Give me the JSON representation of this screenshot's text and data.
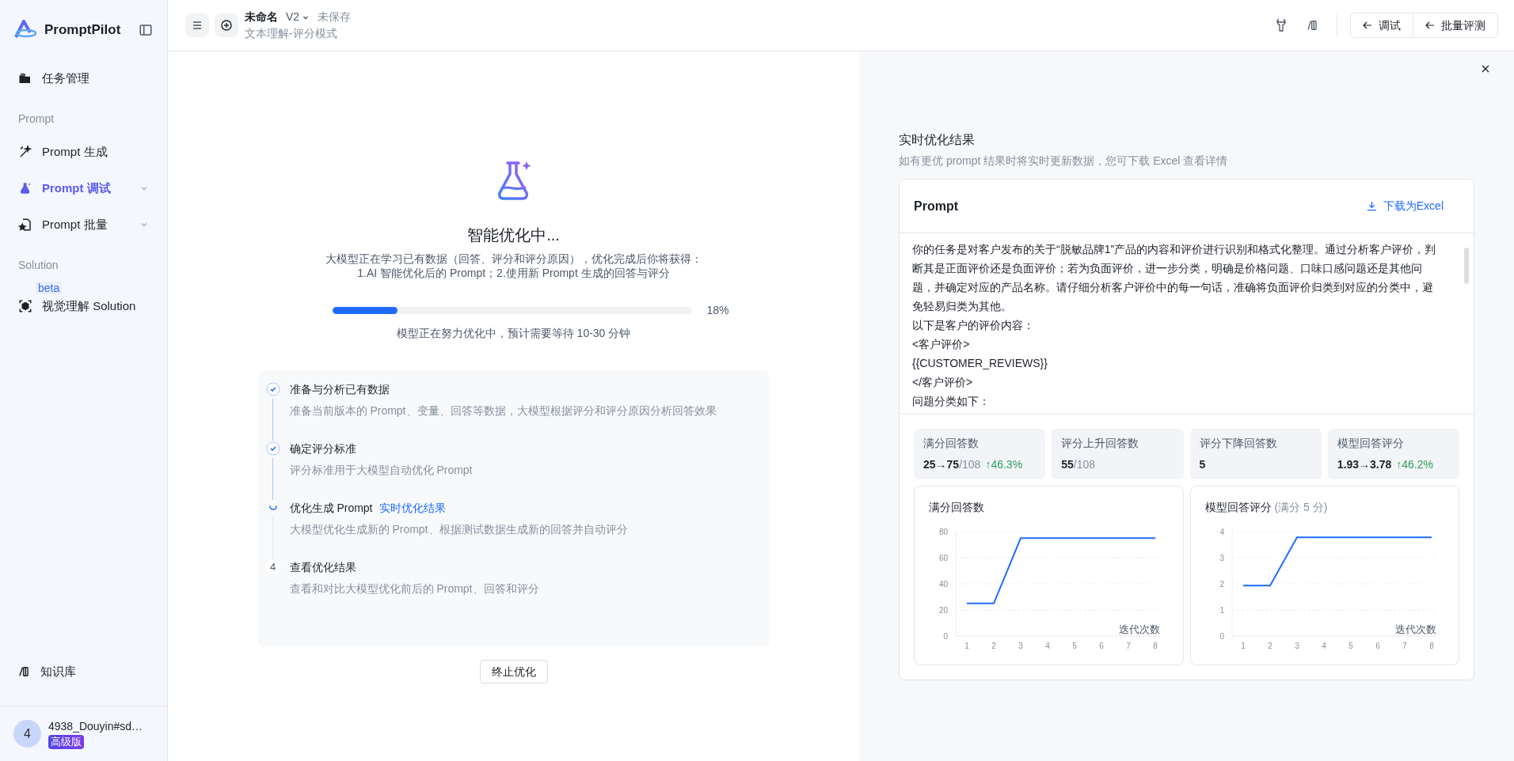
{
  "sidebar": {
    "logo": "PromptPilot",
    "items": [
      {
        "kind": "item",
        "label": "任务管理",
        "selected": false,
        "expandable": false
      },
      {
        "kind": "section",
        "label": "Prompt"
      },
      {
        "kind": "item",
        "label": "Prompt 生成",
        "selected": false,
        "expandable": false
      },
      {
        "kind": "item",
        "label": "Prompt 调试",
        "selected": true,
        "expandable": true
      },
      {
        "kind": "item",
        "label": "Prompt 批量",
        "selected": false,
        "expandable": true
      },
      {
        "kind": "section",
        "label": "Solution"
      },
      {
        "kind": "item",
        "label": "视觉理解 Solution",
        "selected": false,
        "expandable": false,
        "badge": "beta"
      }
    ],
    "bottom_item": "知识库",
    "user": {
      "avatar": "4",
      "name": "4938_Douyin#sd…",
      "plan": "高级版"
    }
  },
  "header": {
    "title": "未命名",
    "version": "V2",
    "save_state": "未保存",
    "subtitle": "文本理解-评分模式",
    "buttons": [
      "调试",
      "批量评测"
    ]
  },
  "optimization": {
    "title": "智能优化中...",
    "description": [
      "大模型正在学习已有数据（回答、评分和评分原因），优化完成后你将获得：",
      "1.AI 智能优化后的 Prompt；2.使用新 Prompt 生成的回答与评分"
    ],
    "progress": {
      "level": 0.18,
      "reading": "18%"
    },
    "eta": "模型正在努力优化中，预计需要等待 10-30 分钟",
    "steps": [
      {
        "kind": "done",
        "title": "准备与分析已有数据",
        "description": "准备当前版本的 Prompt、变量、回答等数据，大模型根据评分和评分原因分析回答效果"
      },
      {
        "kind": "done",
        "title": "确定评分标准",
        "description": "评分标准用于大模型自动优化 Prompt"
      },
      {
        "kind": "running",
        "title": "优化生成 Prompt",
        "link": "实时优化结果",
        "description": "大模型优化生成新的 Prompt、根据测试数据生成新的回答并自动评分"
      },
      {
        "kind": "pending",
        "marker": "4",
        "title": "查看优化结果",
        "description": "查看和对比大模型优化前后的 Prompt、回答和评分"
      }
    ],
    "stop_button": "终止优化"
  },
  "results": {
    "title": "实时优化结果",
    "subtitle": "如有更优 prompt 结果时将实时更新数据，您可下载 Excel 查看详情",
    "card_title": "Prompt",
    "download": "下载为Excel",
    "prompt_lines": [
      "你的任务是对客户发布的关于“脱敏品牌1”产品的内容和评价进行识别和格式化整理。通过分析客户评价，判断其是正面评价还是负面评价；若为负面评价，进一步分类，明确是价格问题、口味口感问题还是其他问题，并确定对应的产品名称。请仔细分析客户评价中的每一句话，准确将负面评价归类到对应的分类中，避免轻易归类为其他。",
      "以下是客户的评价内容：",
      "<客户评价>",
      "{{CUSTOMER_REVIEWS}}",
      "</客户评价>",
      "问题分类如下："
    ],
    "stats": [
      {
        "label": "满分回答数",
        "value": "25→75",
        "total": "/108",
        "change": "↑46.3%"
      },
      {
        "label": "评分上升回答数",
        "value": "55",
        "total": "/108"
      },
      {
        "label": "评分下降回答数",
        "value": "5"
      },
      {
        "label": "模型回答评分",
        "value": "1.93→3.78",
        "change": "↑46.2%"
      }
    ],
    "charts": [
      {
        "chart_data": {
          "type": "line",
          "title": "满分回答数",
          "xlabel": "迭代次数",
          "grid": true,
          "x": [
            1,
            2,
            3,
            4,
            5,
            6,
            7,
            8
          ],
          "ylim": [
            0,
            80
          ],
          "yticks": [
            0,
            20,
            40,
            60,
            80
          ],
          "series": [
            {
              "color": "#1f6bff",
              "values": [
                25,
                25,
                75,
                75,
                75,
                75,
                75,
                75
              ]
            }
          ]
        }
      },
      {
        "title_note": "(满分 5 分)",
        "chart_data": {
          "type": "line",
          "title": "模型回答评分",
          "xlabel": "迭代次数",
          "grid": true,
          "x": [
            1,
            2,
            3,
            4,
            5,
            6,
            7,
            8
          ],
          "ylim": [
            0,
            4
          ],
          "yticks": [
            0,
            1,
            2,
            3,
            4
          ],
          "series": [
            {
              "color": "#1f6bff",
              "values": [
                1.93,
                1.93,
                3.78,
                3.78,
                3.78,
                3.78,
                3.78,
                3.78
              ]
            }
          ]
        }
      }
    ]
  }
}
